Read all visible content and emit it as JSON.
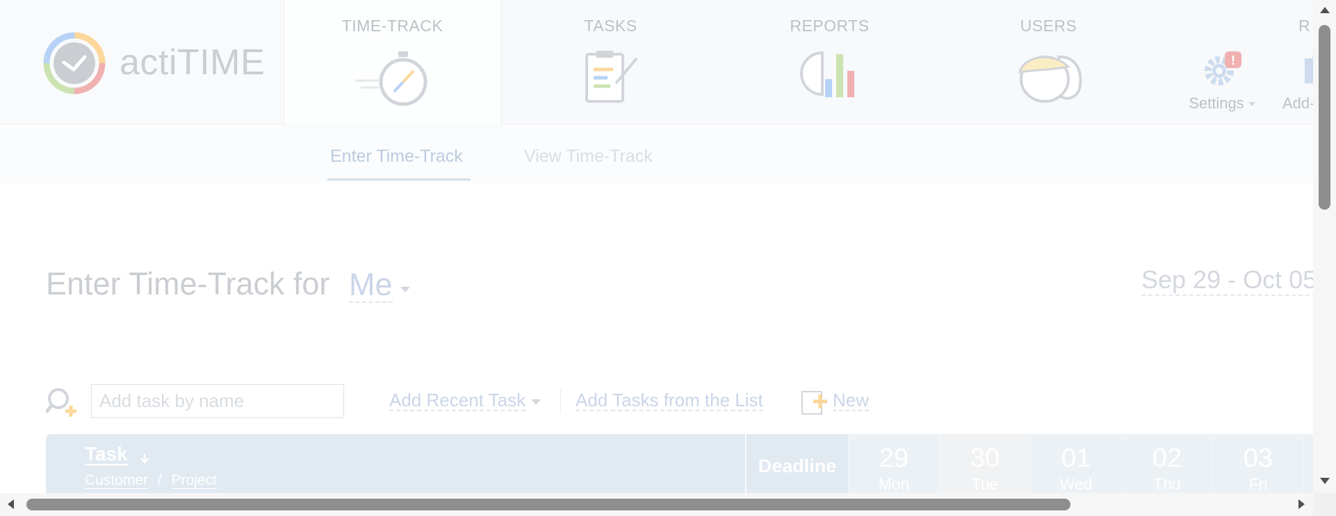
{
  "app": {
    "logo_text": "actiTIME"
  },
  "nav": {
    "tabs": [
      {
        "label": "TIME-TRACK",
        "icon": "stopwatch-icon",
        "active": true
      },
      {
        "label": "TASKS",
        "icon": "clipboard-icon",
        "active": false
      },
      {
        "label": "REPORTS",
        "icon": "reports-chart-icon",
        "active": false
      },
      {
        "label": "USERS",
        "icon": "users-icon",
        "active": false
      }
    ],
    "truncated_tab": "R",
    "settings_label": "Settings",
    "addons_label": "Add-",
    "settings_badge": "!"
  },
  "subnav": {
    "tabs": [
      {
        "label": "Enter Time-Track",
        "active": true
      },
      {
        "label": "View Time-Track",
        "active": false
      }
    ]
  },
  "page": {
    "title": "Enter Time-Track for",
    "user_selector": "Me",
    "date_range": "Sep 29 - Oct 05"
  },
  "toolbar": {
    "search_placeholder": "Add task by name",
    "add_recent_task": "Add Recent Task",
    "add_from_list": "Add Tasks from the List",
    "new_label": "New"
  },
  "grid": {
    "task_header": "Task",
    "customer_label": "Customer",
    "separator": "/",
    "project_label": "Project",
    "deadline_header": "Deadline",
    "days": [
      {
        "num": "29",
        "weekday": "Mon",
        "today": false
      },
      {
        "num": "30",
        "weekday": "Tue",
        "today": true
      },
      {
        "num": "01",
        "weekday": "Wed",
        "today": false
      },
      {
        "num": "02",
        "weekday": "Thu",
        "today": false
      },
      {
        "num": "03",
        "weekday": "Fri",
        "today": false
      }
    ]
  },
  "colors": {
    "header_bg": "#eef1f5",
    "grid_header": "#bccfdf",
    "link": "#8aa3cc",
    "accent_orange": "#f5a623",
    "badge_red": "#e05252"
  }
}
